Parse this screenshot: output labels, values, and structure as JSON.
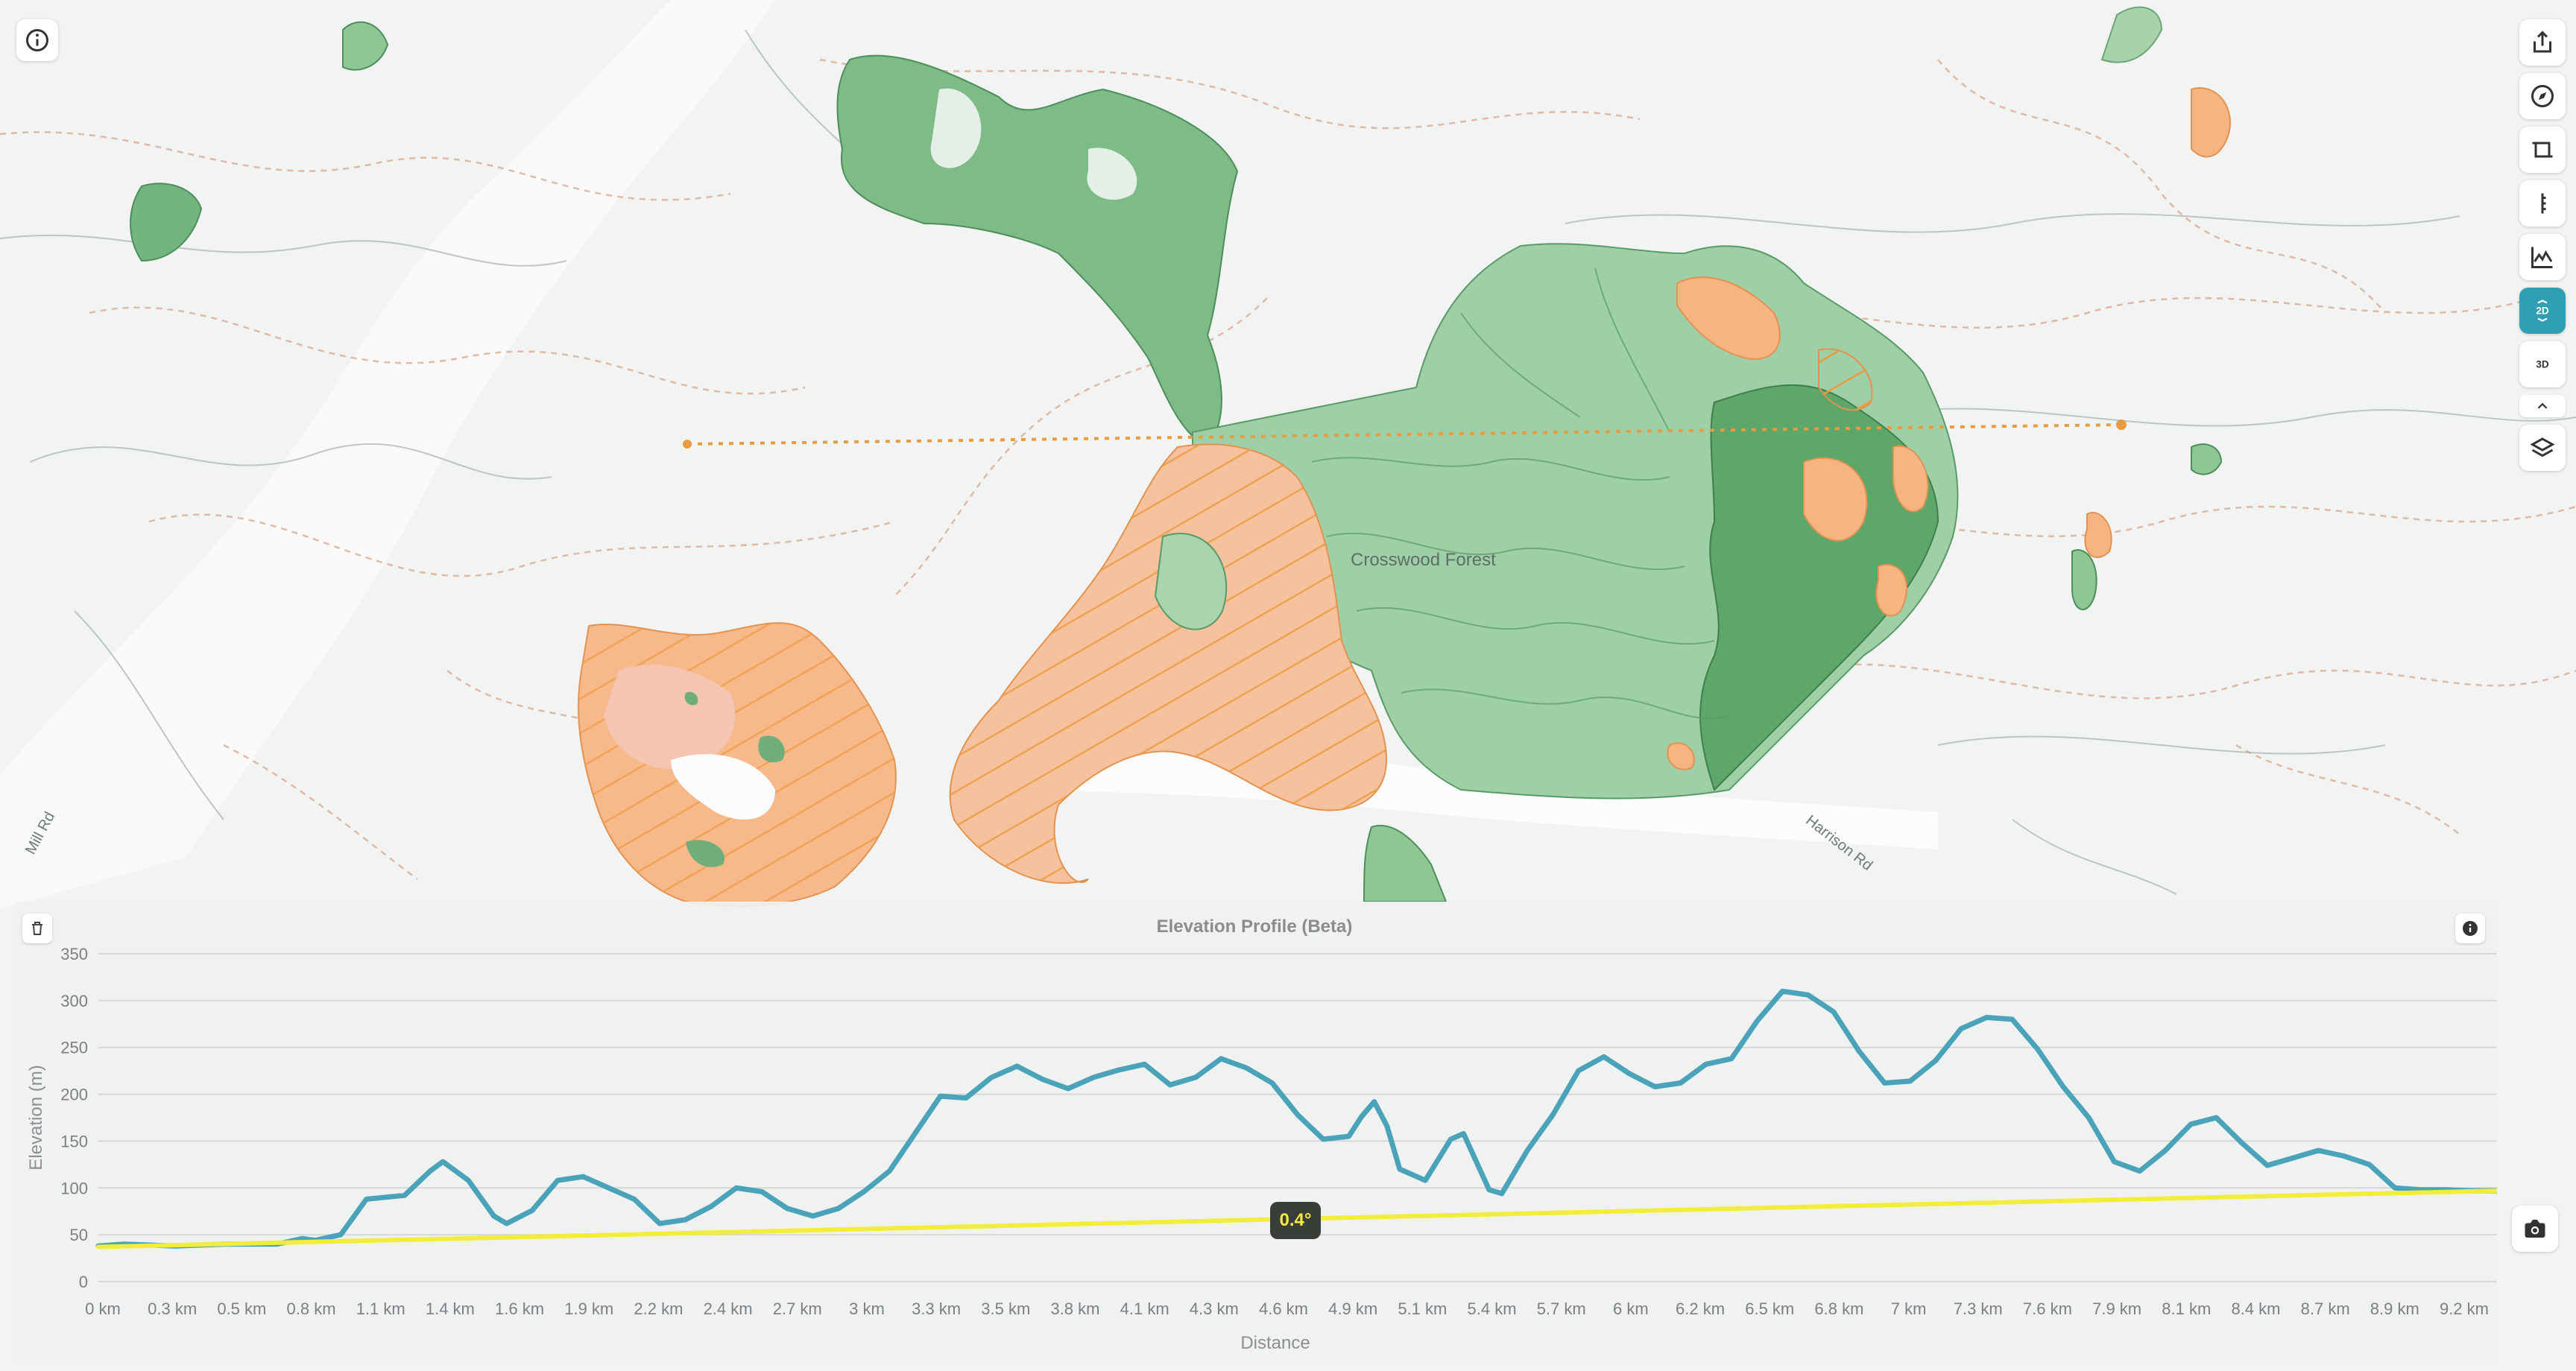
{
  "map": {
    "forest_label": "Crosswood Forest",
    "road_labels": [
      "Mill Rd",
      "Harrison Rd"
    ]
  },
  "buttons": {
    "info": "info-icon",
    "toolbar": [
      "share-icon",
      "compass-icon",
      "crop-icon",
      "ruler-icon",
      "elevation-profile-icon",
      "2d-view-icon",
      "3d-view-icon",
      "chevron-up-icon",
      "layers-icon"
    ],
    "toolbar_2d_label": "2D",
    "toolbar_3d_label": "3D"
  },
  "profile": {
    "title": "Elevation Profile (Beta)",
    "slope_label": "0.4°",
    "camera_icon": "camera-icon",
    "delete_icon": "trash-icon",
    "info_icon": "info-icon"
  },
  "chart_data": {
    "type": "line",
    "title": "Elevation Profile (Beta)",
    "xlabel": "Distance",
    "ylabel": "Elevation (m)",
    "ylim": [
      0,
      350
    ],
    "yticks": [
      0,
      50,
      100,
      150,
      200,
      250,
      300,
      350
    ],
    "xlim": [
      0,
      9.4
    ],
    "xticks": [
      "0 km",
      "0.3 km",
      "0.5 km",
      "0.8 km",
      "1.1 km",
      "1.4 km",
      "1.6 km",
      "1.9 km",
      "2.2 km",
      "2.4 km",
      "2.7 km",
      "3 km",
      "3.3 km",
      "3.5 km",
      "3.8 km",
      "4.1 km",
      "4.3 km",
      "4.6 km",
      "4.9 km",
      "5.1 km",
      "5.4 km",
      "5.7 km",
      "6 km",
      "6.2 km",
      "6.5 km",
      "6.8 km",
      "7 km",
      "7.3 km",
      "7.6 km",
      "7.9 km",
      "8.1 km",
      "8.4 km",
      "8.7 km",
      "8.9 km",
      "9.2 km"
    ],
    "grid": true,
    "series": [
      {
        "color": "#4aa3b8",
        "x": [
          0,
          0.1,
          0.3,
          0.5,
          0.7,
          0.8,
          0.85,
          0.95,
          1.05,
          1.2,
          1.3,
          1.35,
          1.45,
          1.55,
          1.6,
          1.7,
          1.8,
          1.9,
          2.0,
          2.1,
          2.2,
          2.3,
          2.4,
          2.5,
          2.6,
          2.7,
          2.8,
          2.9,
          3.0,
          3.1,
          3.2,
          3.3,
          3.4,
          3.5,
          3.6,
          3.7,
          3.8,
          3.9,
          4.0,
          4.1,
          4.2,
          4.3,
          4.4,
          4.5,
          4.6,
          4.7,
          4.8,
          4.9,
          4.95,
          5.0,
          5.05,
          5.1,
          5.2,
          5.3,
          5.35,
          5.45,
          5.5,
          5.6,
          5.7,
          5.8,
          5.9,
          6.0,
          6.1,
          6.2,
          6.3,
          6.4,
          6.5,
          6.6,
          6.7,
          6.8,
          6.9,
          7.0,
          7.1,
          7.2,
          7.3,
          7.4,
          7.5,
          7.6,
          7.7,
          7.8,
          7.9,
          8.0,
          8.1,
          8.2,
          8.3,
          8.4,
          8.5,
          8.6,
          8.7,
          8.8,
          8.9,
          9.0,
          9.1,
          9.2,
          9.3,
          9.4
        ],
        "y": [
          38,
          40,
          38,
          40,
          40,
          46,
          44,
          50,
          88,
          92,
          118,
          128,
          108,
          70,
          62,
          76,
          108,
          112,
          100,
          88,
          62,
          66,
          80,
          100,
          96,
          78,
          70,
          78,
          96,
          118,
          158,
          198,
          196,
          218,
          230,
          216,
          206,
          218,
          226,
          232,
          210,
          218,
          238,
          228,
          212,
          178,
          152,
          155,
          176,
          192,
          166,
          120,
          108,
          152,
          158,
          98,
          94,
          140,
          178,
          225,
          240,
          222,
          208,
          212,
          232,
          238,
          278,
          310,
          306,
          288,
          246,
          212,
          214,
          236,
          270,
          282,
          280,
          248,
          208,
          175,
          128,
          118,
          140,
          168,
          175,
          148,
          124,
          132,
          140,
          134,
          125,
          100,
          98,
          98,
          97,
          97
        ]
      },
      {
        "color": "#f2ed3a",
        "x": [
          0,
          9.4
        ],
        "y": [
          37,
          97
        ]
      }
    ]
  }
}
